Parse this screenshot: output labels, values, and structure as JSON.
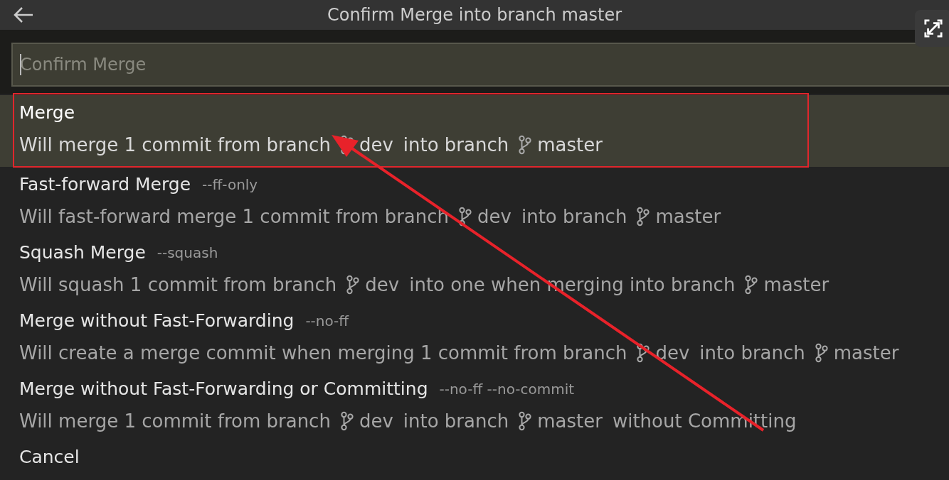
{
  "window": {
    "title": "Confirm Merge into branch master"
  },
  "search": {
    "placeholder": "Confirm Merge"
  },
  "items": [
    {
      "label": "Merge",
      "selected": true,
      "detail": [
        {
          "kind": "text",
          "text": "Will merge 1 commit from branch"
        },
        {
          "kind": "branch",
          "text": "dev"
        },
        {
          "kind": "text",
          "text": "into branch"
        },
        {
          "kind": "branch",
          "text": "master"
        }
      ]
    },
    {
      "label": "Fast-forward Merge",
      "description": "--ff-only",
      "selected": false,
      "detail": [
        {
          "kind": "text",
          "text": "Will fast-forward merge 1 commit from branch"
        },
        {
          "kind": "branch",
          "text": "dev"
        },
        {
          "kind": "text",
          "text": "into branch"
        },
        {
          "kind": "branch",
          "text": "master"
        }
      ]
    },
    {
      "label": "Squash Merge",
      "description": "--squash",
      "selected": false,
      "detail": [
        {
          "kind": "text",
          "text": "Will squash 1 commit from branch"
        },
        {
          "kind": "branch",
          "text": "dev"
        },
        {
          "kind": "text",
          "text": "into one when merging into branch"
        },
        {
          "kind": "branch",
          "text": "master"
        }
      ]
    },
    {
      "label": "Merge without Fast-Forwarding",
      "description": "--no-ff",
      "selected": false,
      "detail": [
        {
          "kind": "text",
          "text": "Will create a merge commit when merging 1 commit from branch"
        },
        {
          "kind": "branch",
          "text": "dev"
        },
        {
          "kind": "text",
          "text": "into branch"
        },
        {
          "kind": "branch",
          "text": "master"
        }
      ]
    },
    {
      "label": "Merge without Fast-Forwarding or Committing",
      "description": "--no-ff --no-commit",
      "selected": false,
      "detail": [
        {
          "kind": "text",
          "text": "Will merge 1 commit from branch"
        },
        {
          "kind": "branch",
          "text": "dev"
        },
        {
          "kind": "text",
          "text": "into branch"
        },
        {
          "kind": "branch",
          "text": "master"
        },
        {
          "kind": "text",
          "text": "without Committing"
        }
      ]
    },
    {
      "label": "Cancel",
      "selected": false
    }
  ]
}
